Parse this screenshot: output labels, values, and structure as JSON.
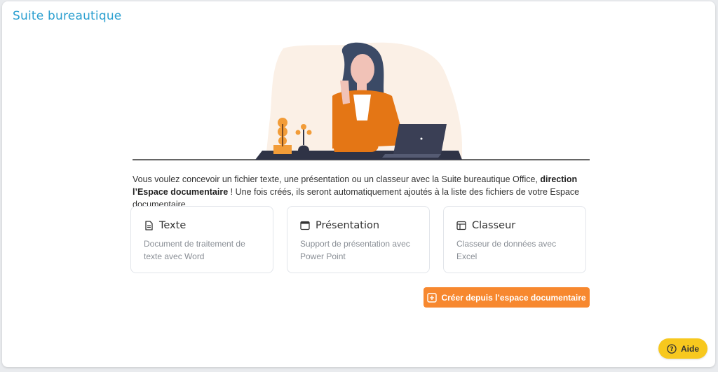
{
  "page": {
    "title": "Suite bureautique"
  },
  "intro": {
    "text_before": "Vous voulez concevoir un fichier texte, une présentation ou un classeur avec la Suite bureautique Office, ",
    "bold_link": "direction l’Espace documentaire",
    "text_after": " ! Une fois créés, ils seront automatiquement ajoutés à la liste des fichiers de votre Espace documentaire."
  },
  "tiles": [
    {
      "icon": "document-icon",
      "title": "Texte",
      "description": "Document de traitement de texte avec Word"
    },
    {
      "icon": "presentation-icon",
      "title": "Présentation",
      "description": "Support de présentation avec Power Point"
    },
    {
      "icon": "spreadsheet-icon",
      "title": "Classeur",
      "description": "Classeur de données avec Excel"
    }
  ],
  "actions": {
    "create_label": "Créer depuis l’espace documentaire",
    "help_label": "Aide"
  },
  "colors": {
    "title": "#2a9fd0",
    "accent_orange": "#f7882f",
    "help_yellow": "#f7c81e"
  }
}
